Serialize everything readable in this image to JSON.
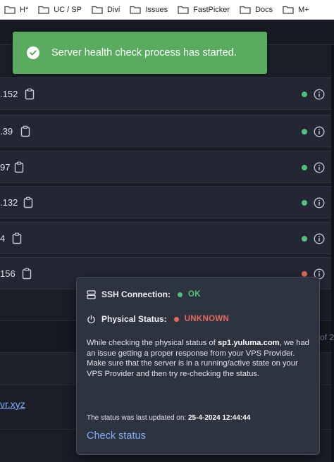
{
  "bookmarks": [
    {
      "label": "H*"
    },
    {
      "label": "UC / SP"
    },
    {
      "label": "Divi"
    },
    {
      "label": "Issues"
    },
    {
      "label": "FastPicker"
    },
    {
      "label": "Docs"
    },
    {
      "label": "M+"
    }
  ],
  "toast": {
    "message": "Server health check process has started.",
    "color": "#5aab5f"
  },
  "servers": [
    {
      "ip_fragment": ".152",
      "status": "ok"
    },
    {
      "ip_fragment": ".39",
      "status": "ok"
    },
    {
      "ip_fragment": "97",
      "status": "ok"
    },
    {
      "ip_fragment": ".132",
      "status": "ok"
    },
    {
      "ip_fragment": "4",
      "status": "ok"
    },
    {
      "ip_fragment": "156",
      "status": "unknown"
    }
  ],
  "status_colors": {
    "ok": "#4fc17a",
    "unknown": "#e46a5e"
  },
  "lower": {
    "side_text": "of 2",
    "domain_link": "vr.xyz"
  },
  "popover": {
    "ssh_label": "SSH Connection:",
    "ssh_value": "OK",
    "physical_label": "Physical Status:",
    "physical_value": "UNKNOWN",
    "desc_prefix": "While checking the physical status of ",
    "hostname": "sp1.yuluma.com",
    "desc_suffix": ", we had an issue getting a proper response from your VPS Provider. Make sure that the server is in a running/active state on your VPS Provider and then try re-checking the status.",
    "updated_label": "The status was last updated on: ",
    "updated_value": "25-4-2024 12:44:44",
    "action_label": "Check status"
  }
}
